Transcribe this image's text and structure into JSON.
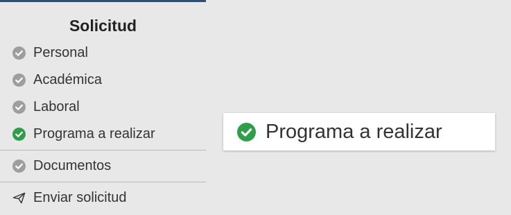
{
  "sidebar": {
    "title": "Solicitud",
    "items": [
      {
        "label": "Personal",
        "status": "complete-grey"
      },
      {
        "label": "Académica",
        "status": "complete-grey"
      },
      {
        "label": "Laboral",
        "status": "complete-grey"
      },
      {
        "label": "Programa a realizar",
        "status": "complete-green"
      },
      {
        "label": "Documentos",
        "status": "complete-grey"
      },
      {
        "label": "Enviar solicitud",
        "icon": "paper-plane-icon"
      }
    ]
  },
  "card": {
    "label": "Programa a realizar",
    "icon": "check-circle-icon"
  },
  "colors": {
    "accent_bar": "#2d4f73",
    "check_grey": "#9e9e9e",
    "check_green": "#2e9e48"
  }
}
